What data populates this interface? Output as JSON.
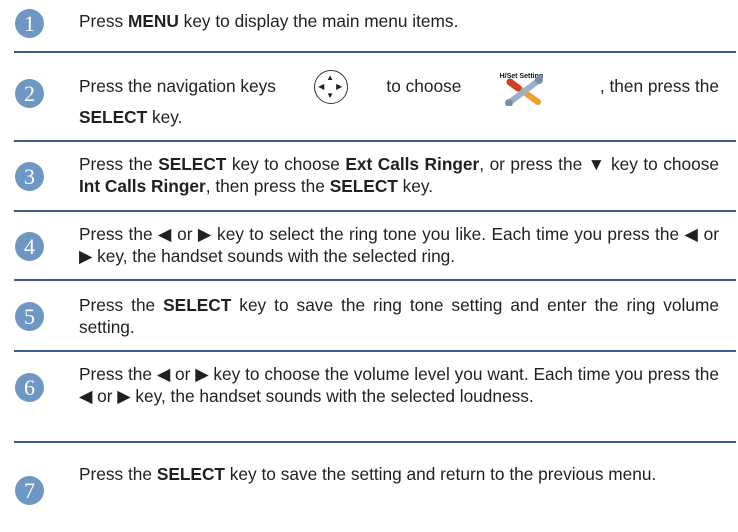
{
  "steps": [
    {
      "number": "1",
      "text": [
        "Press ",
        {
          "b": "MENU"
        },
        " key to display the main menu items."
      ]
    },
    {
      "number": "2",
      "line1_a": "Press the navigation keys",
      "line1_b": "to choose",
      "line1_c": ", then press the",
      "line2_b": "SELECT",
      "line2_c": " key.",
      "icon_caption": "H/Set Setting",
      "icon": "wrench-screwdriver-icon"
    },
    {
      "number": "3",
      "text": [
        "Press the ",
        {
          "b": "SELECT"
        },
        " key to choose ",
        {
          "b": "Ext Calls Ringer"
        },
        ", or press the ▼ key to choose ",
        {
          "b": "Int Calls Ringer"
        },
        ", then press the ",
        {
          "b": "SELECT"
        },
        " key."
      ]
    },
    {
      "number": "4",
      "text": [
        "Press the ◀ or ▶ key to select the ring tone you like. Each time you press the ◀ or ▶ key, the handset sounds with the selected ring."
      ]
    },
    {
      "number": "5",
      "text": [
        "Press the ",
        {
          "b": "SELECT"
        },
        " key to save the ring tone setting and enter the ring volume setting."
      ]
    },
    {
      "number": "6",
      "text": [
        "Press the ◀ or ▶ key to choose the volume level you want. Each time you press the ◀ or ▶ key, the handset sounds with the selected loudness."
      ]
    },
    {
      "number": "7",
      "text": [
        "Press the ",
        {
          "b": "SELECT"
        },
        " key to save the setting and return to the previous menu."
      ]
    }
  ],
  "colors": {
    "accent": "#6e97c4",
    "divider": "#3a5b8c"
  }
}
